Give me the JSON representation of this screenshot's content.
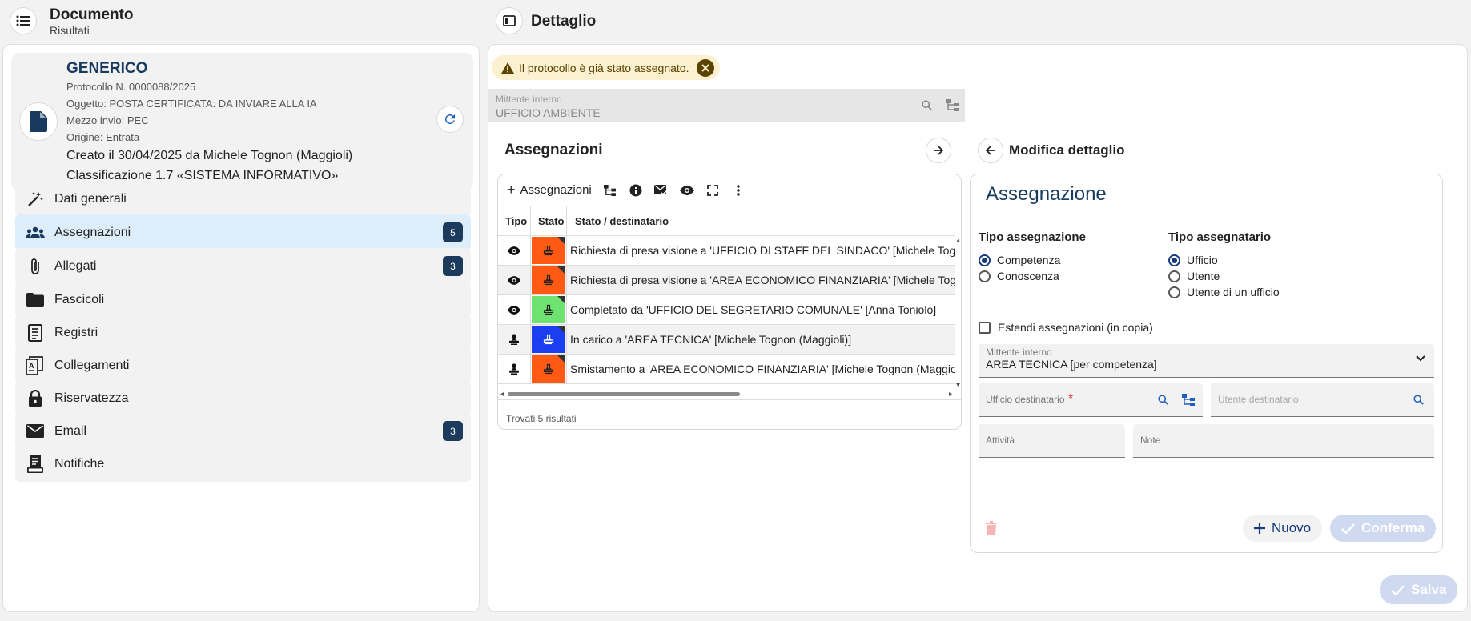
{
  "left_header": {
    "title": "Documento",
    "subtitle": "Risultati"
  },
  "right_header": {
    "title": "Dettaglio"
  },
  "document": {
    "type": "GENERICO",
    "protocol": "Protocollo N. 0000088/2025",
    "subject": "Oggetto: POSTA CERTIFICATA: DA INVIARE ALLA IA",
    "send_means": "Mezzo invio: PEC",
    "origin": "Origine: Entrata",
    "created": "Creato il 30/04/2025 da Michele Tognon (Maggioli)",
    "classification": "Classificazione 1.7 «SISTEMA INFORMATIVO»"
  },
  "menu": [
    {
      "label": "Dati generali",
      "icon": "magic-wand-icon",
      "badge": ""
    },
    {
      "label": "Assegnazioni",
      "icon": "group-icon",
      "badge": "5"
    },
    {
      "label": "Allegati",
      "icon": "paperclip-icon",
      "badge": "3"
    },
    {
      "label": "Fascicoli",
      "icon": "folder-icon",
      "badge": ""
    },
    {
      "label": "Registri",
      "icon": "register-icon",
      "badge": ""
    },
    {
      "label": "Collegamenti",
      "icon": "link-document-icon",
      "badge": ""
    },
    {
      "label": "Riservatezza",
      "icon": "lock-icon",
      "badge": ""
    },
    {
      "label": "Email",
      "icon": "mail-icon",
      "badge": "3"
    },
    {
      "label": "Notifiche",
      "icon": "receipt-icon",
      "badge": ""
    }
  ],
  "alert": {
    "text": "Il protocollo è già stato assegnato."
  },
  "mittente_top": {
    "label": "Mittente interno",
    "value": "UFFICIO AMBIENTE"
  },
  "assegnazioni": {
    "title": "Assegnazioni",
    "add_label": "Assegnazioni",
    "columns": [
      "Tipo",
      "Stato",
      "Stato / destinatario"
    ],
    "rows": [
      {
        "tipo_icon": "eye-icon",
        "status_color": "#ff5a14",
        "text": "Richiesta di presa visione a 'UFFICIO DI STAFF DEL SINDACO' [Michele Tognon (Maggioli)]"
      },
      {
        "tipo_icon": "eye-icon",
        "status_color": "#ff5a14",
        "text": "Richiesta di presa visione a 'AREA ECONOMICO FINANZIARIA' [Michele Tognon (Maggioli)]"
      },
      {
        "tipo_icon": "eye-icon",
        "status_color": "#6fe36f",
        "text": "Completato da 'UFFICIO DEL SEGRETARIO COMUNALE' [Anna Toniolo]"
      },
      {
        "tipo_icon": "stamp-icon",
        "status_color": "#1a3ff0",
        "text": "In carico a 'AREA TECNICA' [Michele Tognon (Maggioli)]"
      },
      {
        "tipo_icon": "stamp-icon",
        "status_color": "#ff5a14",
        "text": "Smistamento a 'AREA ECONOMICO FINANZIARIA' [Michele Tognon (Maggioli)]"
      }
    ],
    "footer": "Trovati 5 risultati"
  },
  "detail": {
    "header": "Modifica dettaglio",
    "title": "Assegnazione",
    "tipo_assegnazione": {
      "label": "Tipo assegnazione",
      "options": [
        "Competenza",
        "Conoscenza"
      ],
      "selected": "Competenza"
    },
    "tipo_assegnatario": {
      "label": "Tipo assegnatario",
      "options": [
        "Ufficio",
        "Utente",
        "Utente di un ufficio"
      ],
      "selected": "Ufficio"
    },
    "estendi_label": "Estendi assegnazioni (in copia)",
    "mittente": {
      "label": "Mittente interno",
      "value": "AREA TECNICA [per competenza]"
    },
    "ufficio_label": "Ufficio destinatario",
    "utente_label": "Utente destinatario",
    "attivita_label": "Attività",
    "note_label": "Note",
    "nuovo_label": "Nuovo",
    "conferma_label": "Conferma"
  },
  "save_label": "Salva",
  "colors": {
    "primary": "#173a5e",
    "accent": "#173a7e",
    "active_menu": "#ddedf9",
    "alert_bg": "#fbf0cf"
  }
}
